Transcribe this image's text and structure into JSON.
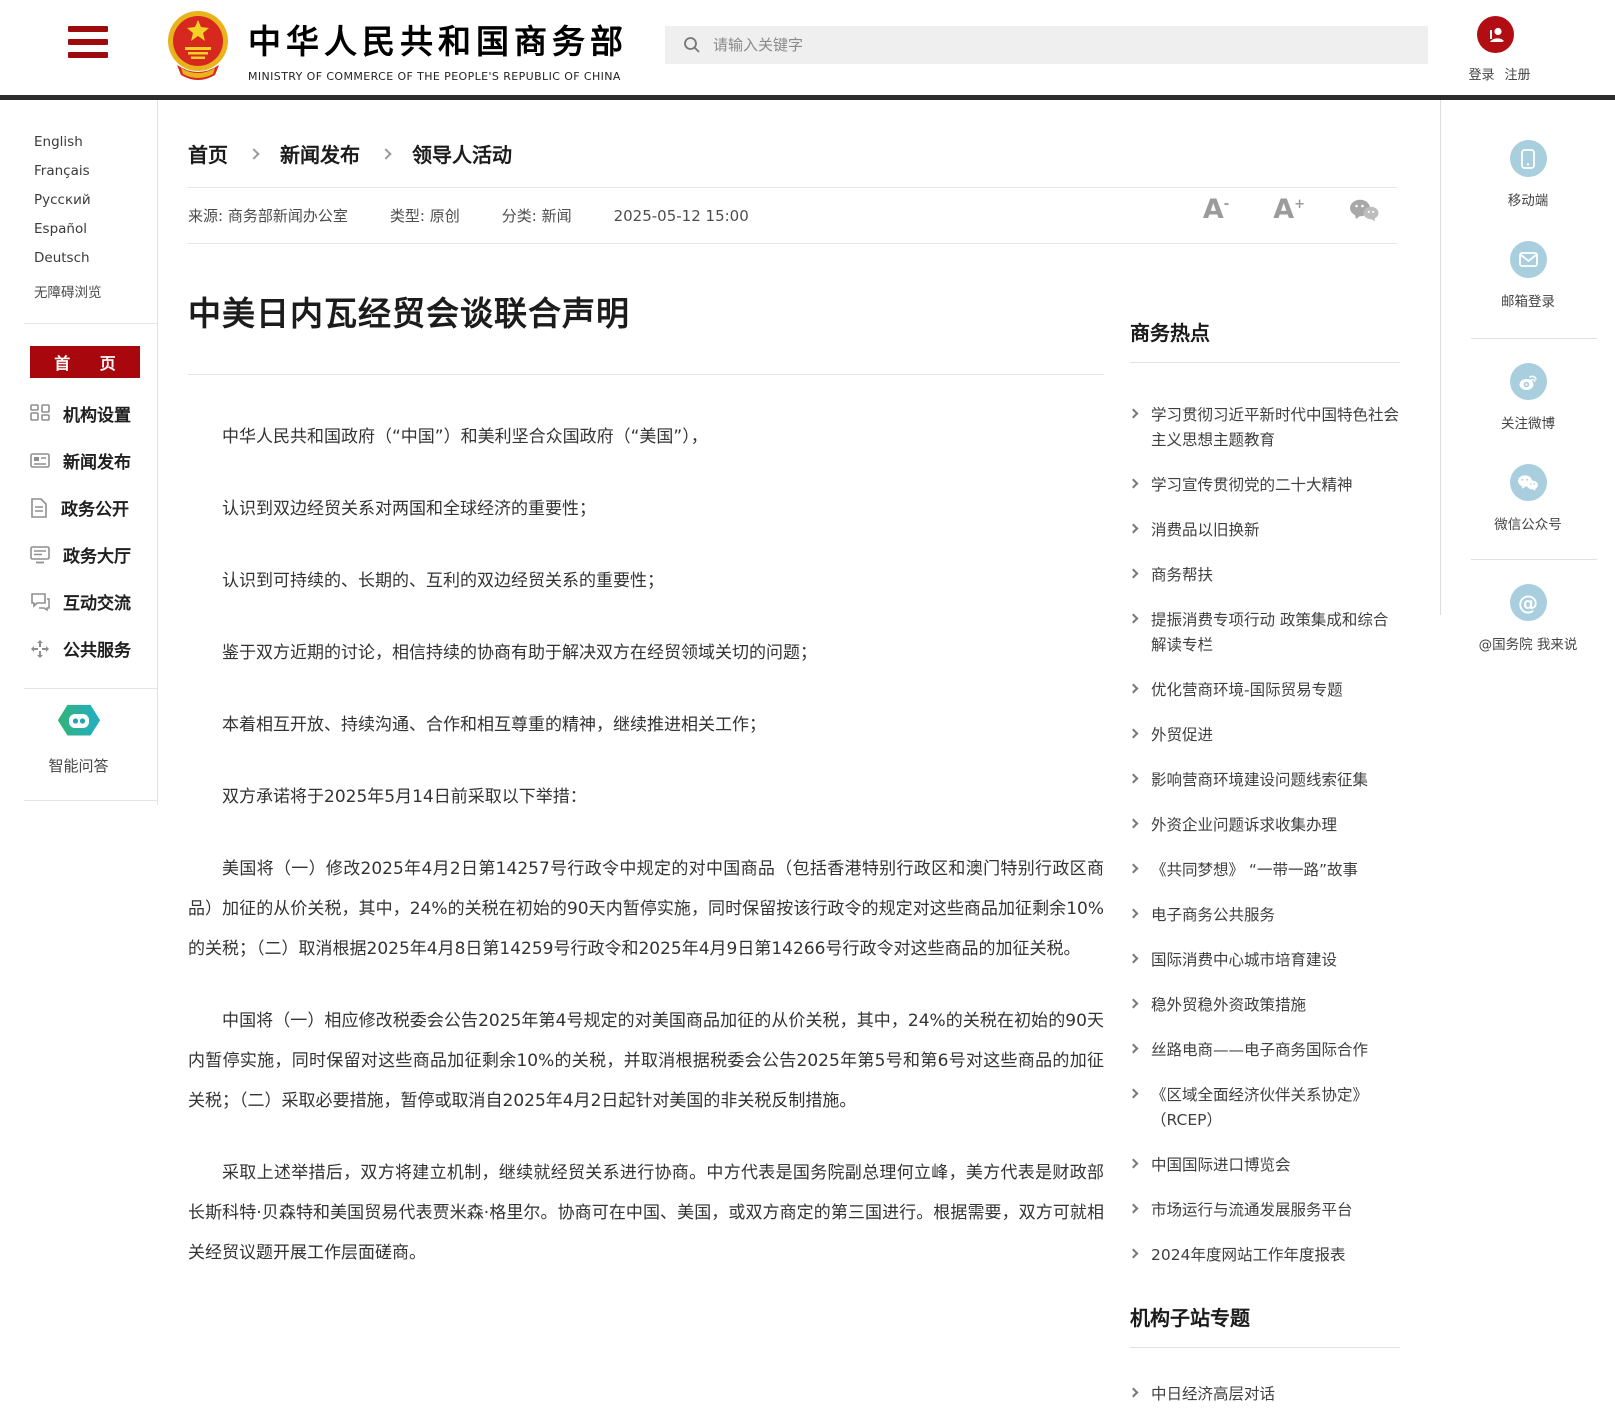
{
  "header": {
    "site_title": "中华人民共和国商务部",
    "site_subtitle": "MINISTRY OF COMMERCE OF THE PEOPLE'S REPUBLIC OF CHINA",
    "search_placeholder": "请输入关键字",
    "login_label": "登录",
    "register_label": "注册"
  },
  "left_sidebar": {
    "languages": [
      "English",
      "Français",
      "Русский",
      "Español",
      "Deutsch"
    ],
    "accessibility_label": "无障碍浏览",
    "home_label": "首 页",
    "menu": [
      {
        "icon": "org-grid-icon",
        "label": "机构设置"
      },
      {
        "icon": "news-icon",
        "label": "新闻发布"
      },
      {
        "icon": "document-icon",
        "label": "政务公开"
      },
      {
        "icon": "hall-icon",
        "label": "政务大厅"
      },
      {
        "icon": "chat-icon",
        "label": "互动交流"
      },
      {
        "icon": "service-icon",
        "label": "公共服务"
      }
    ],
    "ai_qa_label": "智能问答"
  },
  "breadcrumb": {
    "items": [
      "首页",
      "新闻发布",
      "领导人活动"
    ]
  },
  "article": {
    "meta": {
      "source_label": "来源:",
      "source": "商务部新闻办公室",
      "type_label": "类型:",
      "type": "原创",
      "category_label": "分类:",
      "category": "新闻",
      "datetime": "2025-05-12 15:00"
    },
    "font_tools": {
      "decrease": "A",
      "decrease_sup": "-",
      "increase": "A",
      "increase_sup": "+"
    },
    "title": "中美日内瓦经贸会谈联合声明",
    "paragraphs": [
      "中华人民共和国政府（“中国”）和美利坚合众国政府（“美国”），",
      "认识到双边经贸关系对两国和全球经济的重要性；",
      "认识到可持续的、长期的、互利的双边经贸关系的重要性；",
      "鉴于双方近期的讨论，相信持续的协商有助于解决双方在经贸领域关切的问题；",
      "本着相互开放、持续沟通、合作和相互尊重的精神，继续推进相关工作；",
      "双方承诺将于2025年5月14日前采取以下举措：",
      "美国将（一）修改2025年4月2日第14257号行政令中规定的对中国商品（包括香港特别行政区和澳门特别行政区商品）加征的从价关税，其中，24%的关税在初始的90天内暂停实施，同时保留按该行政令的规定对这些商品加征剩余10%的关税；（二）取消根据2025年4月8日第14259号行政令和2025年4月9日第14266号行政令对这些商品的加征关税。",
      "中国将（一）相应修改税委会公告2025年第4号规定的对美国商品加征的从价关税，其中，24%的关税在初始的90天内暂停实施，同时保留对这些商品加征剩余10%的关税，并取消根据税委会公告2025年第5号和第6号对这些商品的加征关税；（二）采取必要措施，暂停或取消自2025年4月2日起针对美国的非关税反制措施。",
      "采取上述举措后，双方将建立机制，继续就经贸关系进行协商。中方代表是国务院副总理何立峰，美方代表是财政部长斯科特·贝森特和美国贸易代表贾米森·格里尔。协商可在中国、美国，或双方商定的第三国进行。根据需要，双方可就相关经贸议题开展工作层面磋商。"
    ]
  },
  "hot_topics": {
    "heading": "商务热点",
    "items": [
      "学习贯彻习近平新时代中国特色社会主义思想主题教育",
      "学习宣传贯彻党的二十大精神",
      "消费品以旧换新",
      "商务帮扶",
      "提振消费专项行动 政策集成和综合解读专栏",
      "优化营商环境-国际贸易专题",
      "外贸促进",
      "影响营商环境建设问题线索征集",
      "外资企业问题诉求收集办理",
      "《共同梦想》 “一带一路”故事",
      "电子商务公共服务",
      "国际消费中心城市培育建设",
      "稳外贸稳外资政策措施",
      "丝路电商——电子商务国际合作",
      "《区域全面经济伙伴关系协定》（RCEP）",
      "中国国际进口博览会",
      "市场运行与流通发展服务平台",
      "2024年度网站工作年度报表"
    ]
  },
  "sub_sites": {
    "heading": "机构子站专题",
    "items": [
      "中日经济高层对话"
    ]
  },
  "right_rail": {
    "items": [
      {
        "icon": "mobile-icon",
        "label": "移动端"
      },
      {
        "icon": "mail-icon",
        "label": "邮箱登录"
      },
      {
        "icon": "weibo-icon",
        "label": "关注微博"
      },
      {
        "icon": "wechat-icon",
        "label": "微信公众号"
      },
      {
        "icon": "at-icon",
        "label": "@国务院 我来说"
      }
    ]
  },
  "colors": {
    "brand_red": "#a8070d",
    "topbar_dark": "#2c2c2e",
    "rail_icon_blue": "#a9cedd",
    "search_bg": "#efefef",
    "divider": "#e6e6e6",
    "body_text": "#333333"
  }
}
